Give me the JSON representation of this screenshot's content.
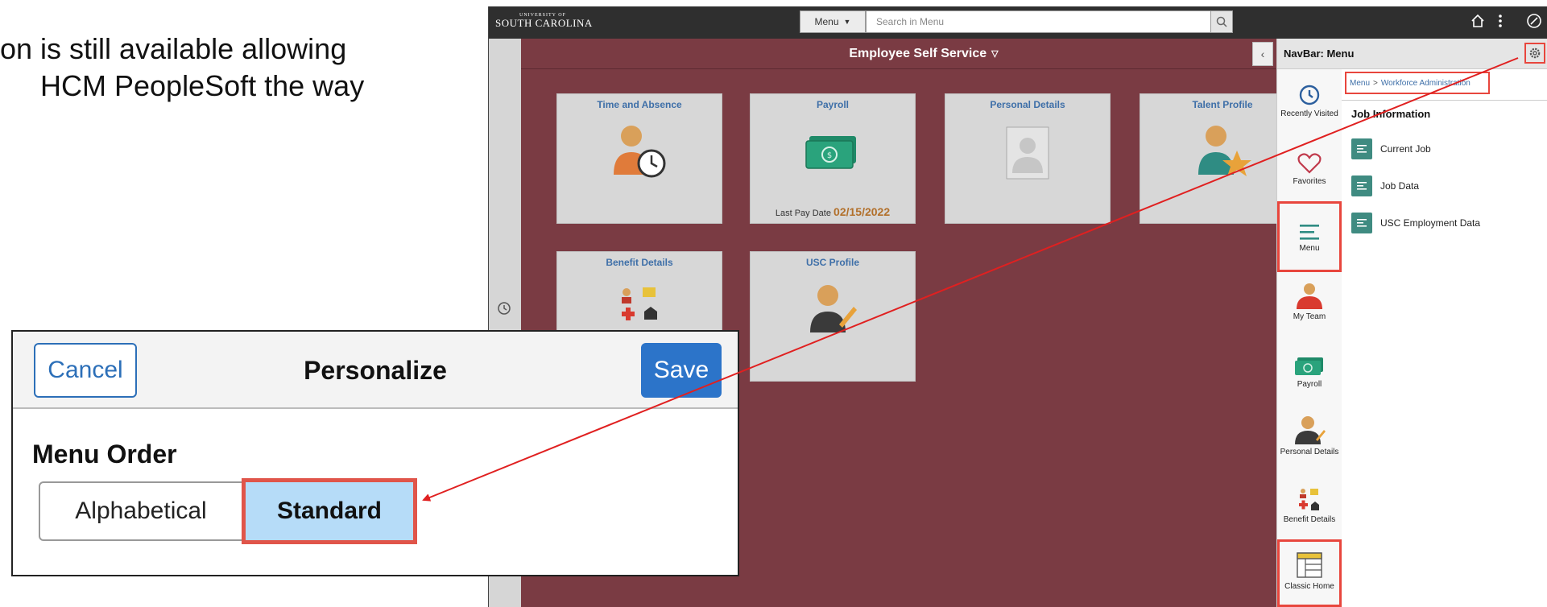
{
  "slide": {
    "line1": "on is still available allowing",
    "line2": "HCM PeopleSoft the way"
  },
  "topbar": {
    "logo_small": "UNIVERSITY OF",
    "logo_big": "SOUTH CAROLINA",
    "menu_label": "Menu",
    "search_placeholder": "Search in Menu",
    "icons": [
      "home-icon",
      "more-vertical-icon",
      "navbar-compass-icon"
    ]
  },
  "main": {
    "title": "Employee Self Service",
    "tiles": [
      {
        "title": "Time and Absence"
      },
      {
        "title": "Payroll",
        "pay_label": "Last Pay Date",
        "pay_date": "02/15/2022"
      },
      {
        "title": "Personal Details"
      },
      {
        "title": "Talent Profile"
      },
      {
        "title": "Benefit Details"
      },
      {
        "title": "USC Profile"
      }
    ]
  },
  "navbar": {
    "title": "NavBar: Menu",
    "items": [
      {
        "label": "Recently Visited",
        "icon": "clock-icon"
      },
      {
        "label": "Favorites",
        "icon": "heart-icon"
      },
      {
        "label": "Menu",
        "icon": "menu-icon"
      },
      {
        "label": "My Team",
        "icon": "team-icon"
      },
      {
        "label": "Payroll",
        "icon": "money-icon"
      },
      {
        "label": "Personal Details",
        "icon": "person-icon"
      },
      {
        "label": "Benefit Details",
        "icon": "benefits-icon"
      },
      {
        "label": "Classic Home",
        "icon": "classic-home-icon"
      }
    ],
    "breadcrumb": {
      "root": "Menu",
      "current": "Workforce Administration"
    },
    "section_title": "Job Information",
    "links": [
      "Current Job",
      "Job Data",
      "USC Employment Data"
    ]
  },
  "dialog": {
    "cancel": "Cancel",
    "title": "Personalize",
    "save": "Save",
    "section": "Menu Order",
    "options": [
      "Alphabetical",
      "Standard"
    ],
    "selected": "Standard"
  },
  "colors": {
    "brand_maroon": "#7a3b43",
    "highlight_red": "#e8463d",
    "link_blue": "#3e6fa8",
    "save_blue": "#2c74c9"
  }
}
